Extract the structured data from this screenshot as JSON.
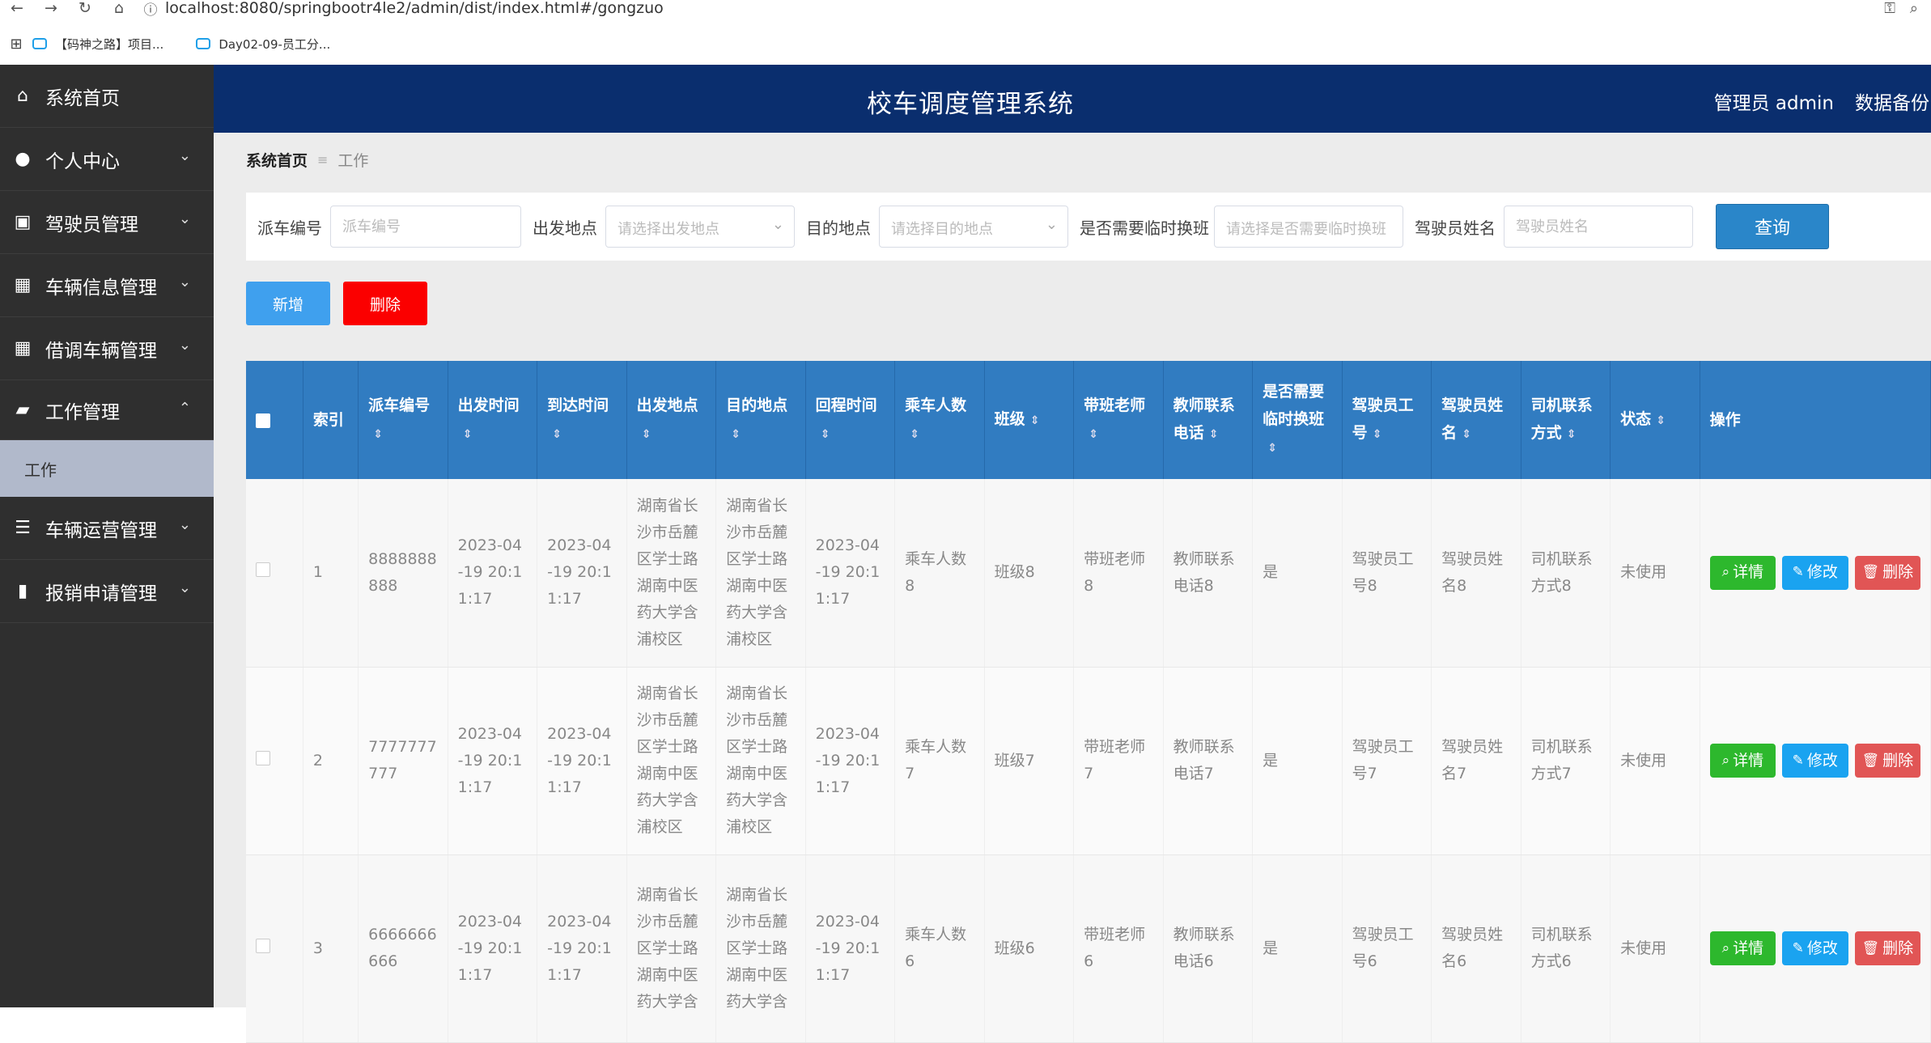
{
  "browser": {
    "url": "localhost:8080/springbootr4le2/admin/dist/index.html#/gongzuo",
    "bookmarks": [
      "【码神之路】项目...",
      "Day02-09-员工分..."
    ]
  },
  "sidebar": {
    "items": [
      {
        "label": "系统首页",
        "icon": "home-icon"
      },
      {
        "label": "个人中心",
        "icon": "user-icon"
      },
      {
        "label": "驾驶员管理",
        "icon": "clipboard-icon"
      },
      {
        "label": "车辆信息管理",
        "icon": "grid-icon"
      },
      {
        "label": "借调车辆管理",
        "icon": "grid-icon"
      },
      {
        "label": "工作管理",
        "icon": "ticket-icon"
      },
      {
        "label": "车辆运营管理",
        "icon": "sliders-icon"
      },
      {
        "label": "报销申请管理",
        "icon": "bar-chart-icon"
      }
    ],
    "sub_item": "工作"
  },
  "header": {
    "title": "校车调度管理系统",
    "user": "管理员 admin",
    "backup": "数据备份"
  },
  "breadcrumb": {
    "home": "系统首页",
    "current": "工作"
  },
  "search": {
    "paiche_label": "派车编号",
    "paiche_placeholder": "派车编号",
    "from_label": "出发地点",
    "from_placeholder": "请选择出发地点",
    "to_label": "目的地点",
    "to_placeholder": "请选择目的地点",
    "swap_label": "是否需要临时换班",
    "swap_placeholder": "请选择是否需要临时换班",
    "driver_label": "驾驶员姓名",
    "driver_placeholder": "驾驶员姓名",
    "query": "查询"
  },
  "actions": {
    "add": "新增",
    "delete": "删除"
  },
  "table": {
    "headers": [
      "索引",
      "派车编号",
      "出发时间",
      "到达时间",
      "出发地点",
      "目的地点",
      "回程时间",
      "乘车人数",
      "班级",
      "带班老师",
      "教师联系电话",
      "是否需要临时换班",
      "驾驶员工号",
      "驾驶员姓名",
      "司机联系方式",
      "状态",
      "操作"
    ],
    "rows": [
      {
        "index": "1",
        "paiche": "8888888888",
        "depart": "2023-04-19 20:11:17",
        "arrive": "2023-04-19 20:11:17",
        "from": "湖南省长沙市岳麓区学士路湖南中医药大学含浦校区",
        "to": "湖南省长沙市岳麓区学士路湖南中医药大学含浦校区",
        "return": "2023-04-19 20:11:17",
        "riders": "乘车人数8",
        "cls": "班级8",
        "teacher": "带班老师8",
        "phone": "教师联系电话8",
        "swap": "是",
        "driver_no": "驾驶员工号8",
        "driver_name": "驾驶员姓名8",
        "driver_phone": "司机联系方式8",
        "status": "未使用"
      },
      {
        "index": "2",
        "paiche": "7777777777",
        "depart": "2023-04-19 20:11:17",
        "arrive": "2023-04-19 20:11:17",
        "from": "湖南省长沙市岳麓区学士路湖南中医药大学含浦校区",
        "to": "湖南省长沙市岳麓区学士路湖南中医药大学含浦校区",
        "return": "2023-04-19 20:11:17",
        "riders": "乘车人数7",
        "cls": "班级7",
        "teacher": "带班老师7",
        "phone": "教师联系电话7",
        "swap": "是",
        "driver_no": "驾驶员工号7",
        "driver_name": "驾驶员姓名7",
        "driver_phone": "司机联系方式7",
        "status": "未使用"
      },
      {
        "index": "3",
        "paiche": "6666666666",
        "depart": "2023-04-19 20:11:17",
        "arrive": "2023-04-19 20:11:17",
        "from": "湖南省长沙市岳麓区学士路湖南中医药大学含",
        "to": "湖南省长沙市岳麓区学士路湖南中医药大学含",
        "return": "2023-04-19 20:11:17",
        "riders": "乘车人数6",
        "cls": "班级6",
        "teacher": "带班老师6",
        "phone": "教师联系电话6",
        "swap": "是",
        "driver_no": "驾驶员工号6",
        "driver_name": "驾驶员姓名6",
        "driver_phone": "司机联系方式6",
        "status": "未使用"
      }
    ],
    "op_labels": {
      "detail": "详情",
      "edit": "修改",
      "delete": "删除"
    }
  },
  "colors": {
    "sidebar_bg": "#2f2f2f",
    "header_bg": "#0a2e6e",
    "table_header_bg": "#317cc1",
    "add_button": "#3fa0ee",
    "delete_button": "#fb0000",
    "detail_button": "#2db82d",
    "edit_button": "#1aa3f0",
    "row_delete_button": "#e15555"
  }
}
